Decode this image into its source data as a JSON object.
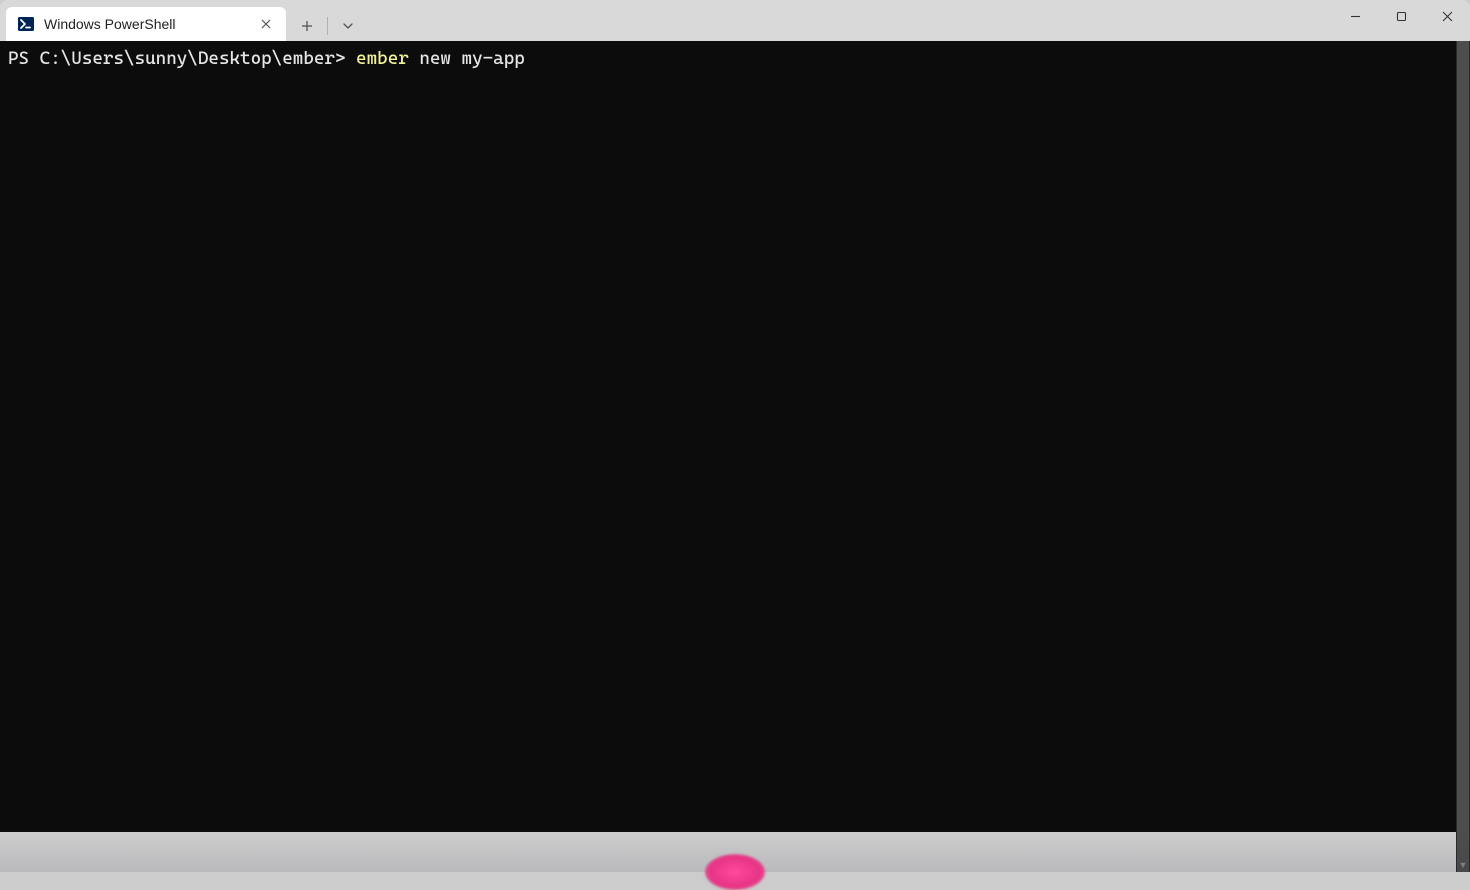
{
  "tab": {
    "title": "Windows PowerShell",
    "icon_name": "powershell-icon"
  },
  "terminal": {
    "prompt": "PS C:\\Users\\sunny\\Desktop\\ember> ",
    "command_keyword": "ember",
    "command_rest": " new my-app"
  }
}
